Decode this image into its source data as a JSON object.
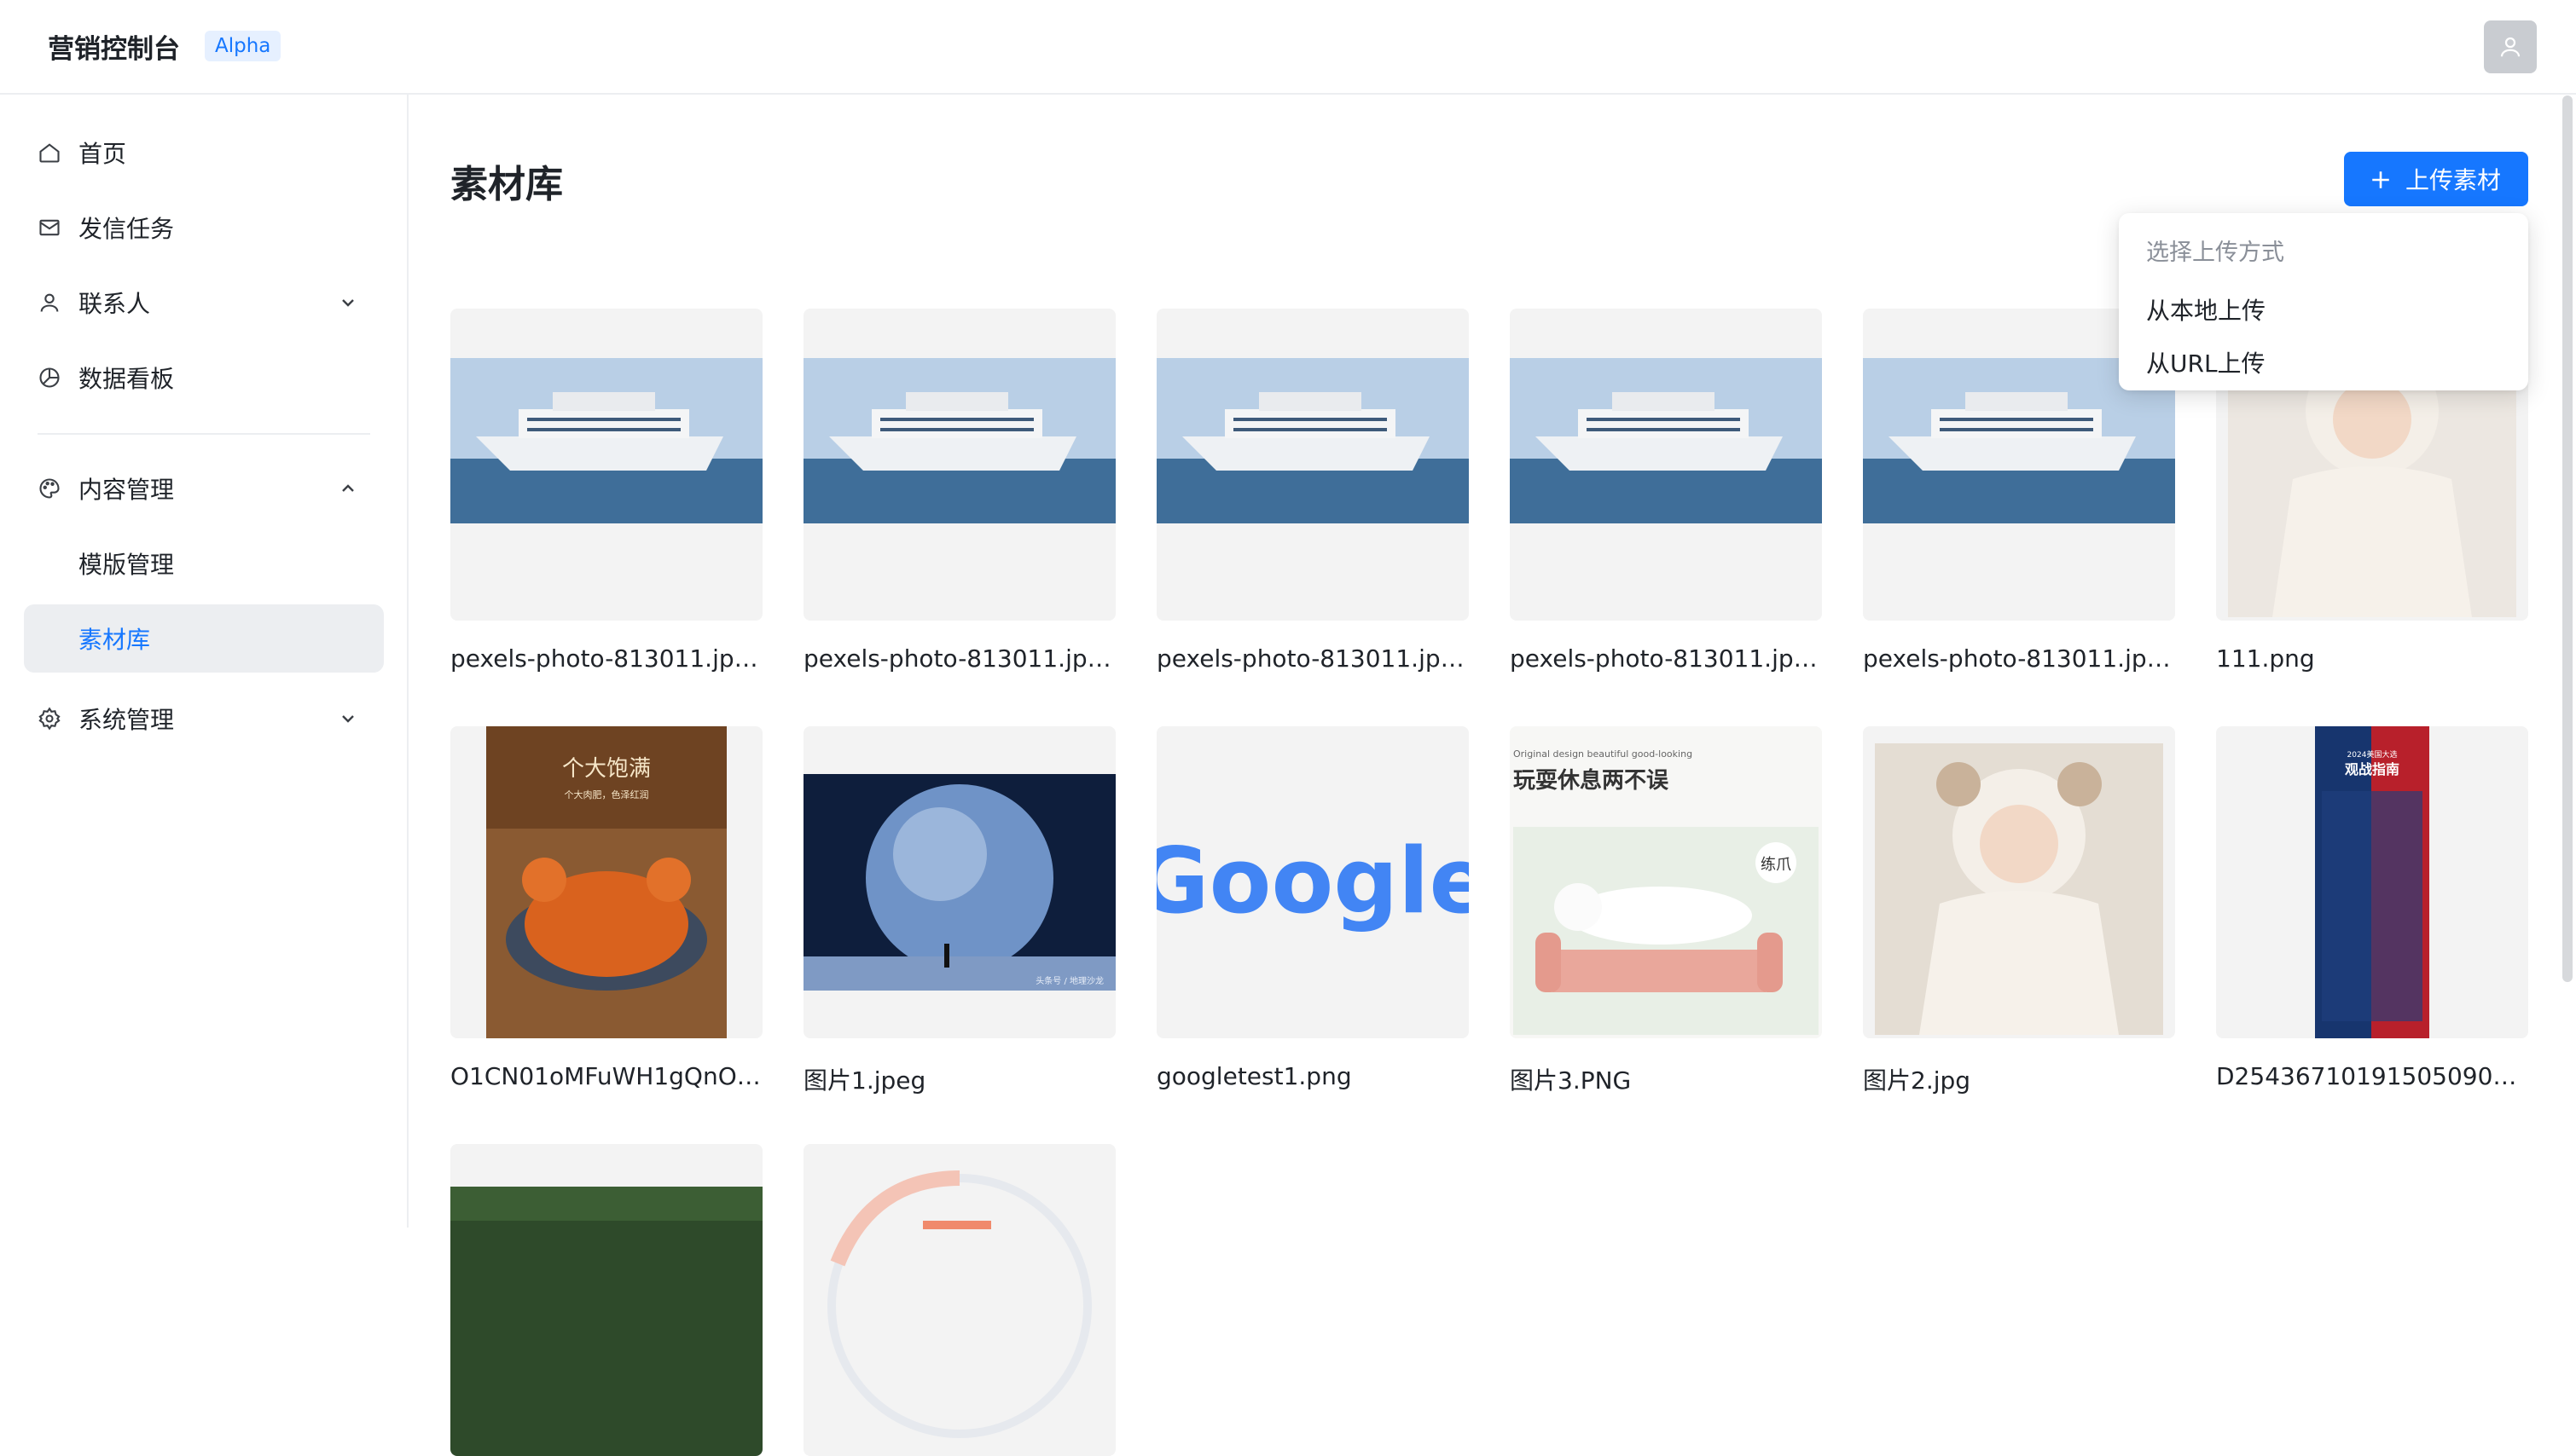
{
  "header": {
    "title": "营销控制台",
    "badge": "Alpha",
    "avatar_icon": "user-icon"
  },
  "sidebar": {
    "items": [
      {
        "label": "首页",
        "icon": "home-icon"
      },
      {
        "label": "发信任务",
        "icon": "mail-icon"
      },
      {
        "label": "联系人",
        "icon": "user-icon"
      },
      {
        "label": "数据看板",
        "icon": "pie-chart-icon"
      },
      {
        "label": "内容管理",
        "icon": "palette-icon"
      },
      {
        "label": "模版管理"
      },
      {
        "label": "素材库"
      },
      {
        "label": "系统管理",
        "icon": "gear-icon"
      }
    ],
    "active_color": "#1677ff"
  },
  "main": {
    "title": "素材库",
    "upload_button": "上传素材",
    "dropdown": {
      "header": "选择上传方式",
      "options": [
        "从本地上传",
        "从URL上传"
      ]
    },
    "assets": [
      {
        "name": "pexels-photo-813011.jpeg",
        "kind": "ship"
      },
      {
        "name": "pexels-photo-813011.jpeg",
        "kind": "ship"
      },
      {
        "name": "pexels-photo-813011.jpeg",
        "kind": "ship"
      },
      {
        "name": "pexels-photo-813011.jpeg",
        "kind": "ship"
      },
      {
        "name": "pexels-photo-813011.jpeg",
        "kind": "ship"
      },
      {
        "name": "111.png",
        "kind": "baby"
      },
      {
        "name": "O1CN01oMFuWH1gQnOg...",
        "kind": "crab",
        "image_text": [
          "个大饱满",
          "个大肉肥，色泽红润"
        ]
      },
      {
        "name": "图片1.jpeg",
        "kind": "earth",
        "image_text": [
          "头条号 / 地理沙龙"
        ]
      },
      {
        "name": "googletest1.png",
        "kind": "google",
        "image_text": [
          "Google"
        ]
      },
      {
        "name": "图片3.PNG",
        "kind": "cat",
        "image_text": [
          "Original design beautiful good-looking",
          "玩耍休息两不误",
          "练爪"
        ]
      },
      {
        "name": "图片2.jpg",
        "kind": "baby"
      },
      {
        "name": "D254367101915050908...",
        "kind": "poster",
        "image_text": [
          "2024美国大选",
          "观战指南"
        ]
      },
      {
        "name": "",
        "kind": "forest"
      },
      {
        "name": "",
        "kind": "circle"
      }
    ]
  },
  "colors": {
    "primary": "#1677ff",
    "border": "#eceef1",
    "thumb_bg": "#f3f3f3"
  }
}
